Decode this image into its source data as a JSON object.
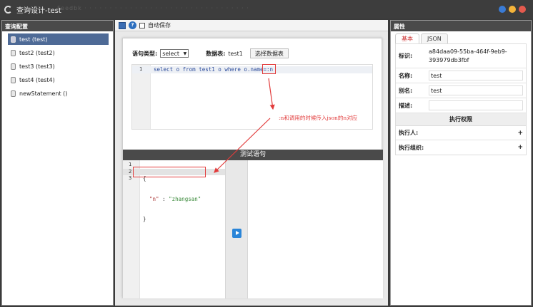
{
  "window": {
    "title": "查询设计-test",
    "ghost_text": "Feedbk · · · · · · · · · · · · · · · · · · · · · · · · · · · · · · · · ·"
  },
  "left": {
    "header": "查询配置",
    "items": [
      {
        "label": "test (test)"
      },
      {
        "label": "test2 (test2)"
      },
      {
        "label": "test3 (test3)"
      },
      {
        "label": "test4 (test4)"
      },
      {
        "label": "newStatement ()"
      }
    ]
  },
  "toolbar": {
    "autosave_label": "自动保存"
  },
  "form": {
    "type_label": "语句类型:",
    "type_value": "select",
    "table_label": "数据表:",
    "table_value": "test1",
    "choose_button": "选择数据表"
  },
  "sql_editor": {
    "line_number": "1",
    "code": "select o from test1 o where o.name=:n"
  },
  "test": {
    "header": "测试语句",
    "line_numbers": [
      "1",
      "2",
      "3"
    ],
    "line1": "{",
    "key": "\"n\"",
    "sep": " : ",
    "value": "\"zhangsan\"",
    "line3": "}"
  },
  "annotation": {
    "text": ":n和调用的时候传入json的n对应",
    "color": "#e23b3b"
  },
  "right": {
    "header": "属性",
    "tabs": [
      "基本",
      "JSON"
    ],
    "id_label": "标识:",
    "id_value": "a84daa09-55ba-464f-9eb9-393979db3fbf",
    "name_label": "名称:",
    "name_value": "test",
    "alias_label": "别名:",
    "alias_value": "test",
    "desc_label": "描述:",
    "desc_value": "",
    "perm_header": "执行权限",
    "executor_label": "执行人:",
    "org_label": "执行组织:",
    "plus": "+"
  },
  "colors": {
    "accent": "#4e6a96",
    "run_button": "#2a85d8",
    "annotation": "#e23b3b"
  }
}
